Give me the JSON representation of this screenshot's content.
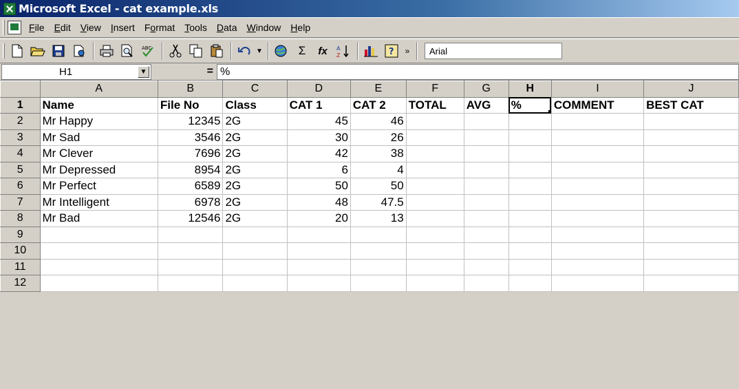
{
  "window": {
    "title": "Microsoft Excel - cat example.xls"
  },
  "menu": [
    {
      "label": "File",
      "key": "F"
    },
    {
      "label": "Edit",
      "key": "E"
    },
    {
      "label": "View",
      "key": "V"
    },
    {
      "label": "Insert",
      "key": "I"
    },
    {
      "label": "Format",
      "key": "o"
    },
    {
      "label": "Tools",
      "key": "T"
    },
    {
      "label": "Data",
      "key": "D"
    },
    {
      "label": "Window",
      "key": "W"
    },
    {
      "label": "Help",
      "key": "H"
    }
  ],
  "toolbar": {
    "icons": [
      "new-icon",
      "open-icon",
      "save-icon",
      "permission-icon",
      "print-icon",
      "print-preview-icon",
      "spelling-icon",
      "cut-icon",
      "copy-icon",
      "paste-icon",
      "undo-icon",
      "undo-dropdown-icon",
      "hyperlink-icon",
      "autosum-icon",
      "function-icon",
      "sort-ascending-icon",
      "chart-wizard-icon",
      "help-icon",
      "more-buttons-icon"
    ],
    "sum_glyph": "Σ",
    "fx_glyph": "fx",
    "font": "Arial"
  },
  "formula_bar": {
    "name_box": "H1",
    "equals": "=",
    "content": "%"
  },
  "sheet": {
    "columns": [
      "A",
      "B",
      "C",
      "D",
      "E",
      "F",
      "G",
      "H",
      "I",
      "J"
    ],
    "active_column": "H",
    "rows": [
      {
        "n": "1",
        "cells": [
          "Name",
          "File No",
          "Class",
          "CAT 1",
          "CAT 2",
          "TOTAL",
          "AVG",
          "%",
          "COMMENT",
          "BEST CAT"
        ]
      },
      {
        "n": "2",
        "cells": [
          "Mr Happy",
          "12345",
          "2G",
          "45",
          "46",
          "",
          "",
          "",
          "",
          ""
        ]
      },
      {
        "n": "3",
        "cells": [
          "Mr Sad",
          "3546",
          "2G",
          "30",
          "26",
          "",
          "",
          "",
          "",
          ""
        ]
      },
      {
        "n": "4",
        "cells": [
          "Mr Clever",
          "7696",
          "2G",
          "42",
          "38",
          "",
          "",
          "",
          "",
          ""
        ]
      },
      {
        "n": "5",
        "cells": [
          "Mr Depressed",
          "8954",
          "2G",
          "6",
          "4",
          "",
          "",
          "",
          "",
          ""
        ]
      },
      {
        "n": "6",
        "cells": [
          "Mr Perfect",
          "6589",
          "2G",
          "50",
          "50",
          "",
          "",
          "",
          "",
          ""
        ]
      },
      {
        "n": "7",
        "cells": [
          "Mr Intelligent",
          "6978",
          "2G",
          "48",
          "47.5",
          "",
          "",
          "",
          "",
          ""
        ]
      },
      {
        "n": "8",
        "cells": [
          "Mr Bad",
          "12546",
          "2G",
          "20",
          "13",
          "",
          "",
          "",
          "",
          ""
        ]
      },
      {
        "n": "9",
        "cells": [
          "",
          "",
          "",
          "",
          "",
          "",
          "",
          "",
          "",
          ""
        ]
      },
      {
        "n": "10",
        "cells": [
          "",
          "",
          "",
          "",
          "",
          "",
          "",
          "",
          "",
          ""
        ]
      },
      {
        "n": "11",
        "cells": [
          "",
          "",
          "",
          "",
          "",
          "",
          "",
          "",
          "",
          ""
        ]
      },
      {
        "n": "12",
        "cells": [
          "",
          "",
          "",
          "",
          "",
          "",
          "",
          "",
          "",
          ""
        ]
      }
    ]
  }
}
